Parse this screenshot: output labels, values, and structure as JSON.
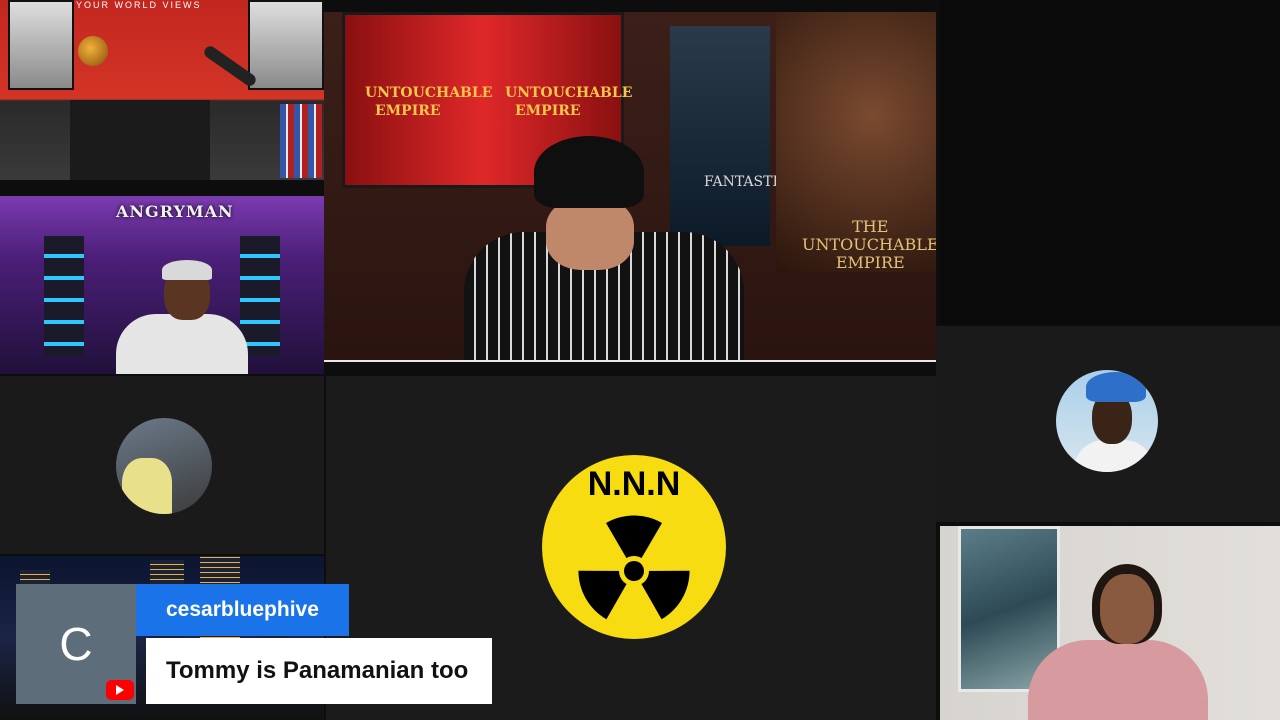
{
  "tiles": {
    "top_left": {
      "banner": "YOUR WORLD VIEWS"
    },
    "left_second": {
      "sign": "ANGRYMAN"
    },
    "main": {
      "tv_text_1": "UNTOUCHABLE",
      "tv_text_2": "EMPIRE",
      "tv_text_3": "UNTOUCHABLE",
      "tv_text_4": "EMPIRE",
      "poster_text": "FANTASTIC",
      "art_text_1": "THE",
      "art_text_2": "UNTOUCHABLE",
      "art_text_3": "EMPIRE"
    },
    "center_logo": {
      "letters": "N.N.N",
      "fill": "#f7dc12",
      "symbol": "radiation-symbol"
    }
  },
  "comment": {
    "avatar_letter": "C",
    "username": "cesarbluephive",
    "message": "Tommy is Panamanian too",
    "platform_icon": "youtube-icon",
    "name_bg": "#1a73e8",
    "avatar_bg": "#5d6e7a"
  }
}
